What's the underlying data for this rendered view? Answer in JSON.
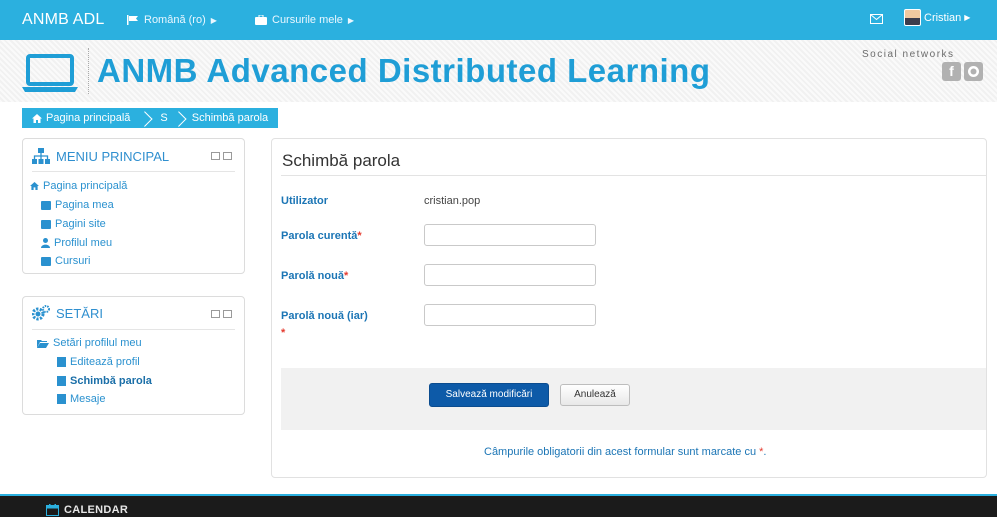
{
  "navbar": {
    "brand": "ANMB ADL",
    "language": "Română (ro)",
    "courses": "Cursurile mele",
    "user_name": "Cristian"
  },
  "header": {
    "site_title": "ANMB Advanced Distributed Learning",
    "social_label": "Social networks",
    "social_icons": [
      "facebook-icon",
      "twitter-icon"
    ]
  },
  "breadcrumb": {
    "home": "Pagina principală",
    "item2": "S",
    "current": "Schimbă parola"
  },
  "main_menu": {
    "title": "MENIU PRINCIPAL",
    "home": "Pagina principală",
    "items": [
      "Pagina mea",
      "Pagini site",
      "Profilul meu",
      "Cursuri"
    ]
  },
  "settings": {
    "title": "SETĂRI",
    "group": "Setări profilul meu",
    "items": [
      "Editează profil",
      "Schimbă parola",
      "Mesaje"
    ]
  },
  "form": {
    "title": "Schimbă parola",
    "user_label": "Utilizator",
    "user_value": "cristian.pop",
    "current_password_label": "Parola curentă",
    "new_password_label": "Parolă nouă",
    "new_password_again_label": "Parolă nouă (iar)",
    "required_mark": "*",
    "save_button": "Salvează modificări",
    "cancel_button": "Anulează",
    "footnote": "Câmpurile obligatorii din acest formular sunt marcate cu"
  },
  "footer": {
    "calendar": "CALENDAR"
  },
  "colors": {
    "accent": "#2bb0df",
    "title": "#1f9ed6",
    "link": "#2a91cf",
    "primary_button": "#0d5aa8",
    "required": "#e53b2f"
  }
}
